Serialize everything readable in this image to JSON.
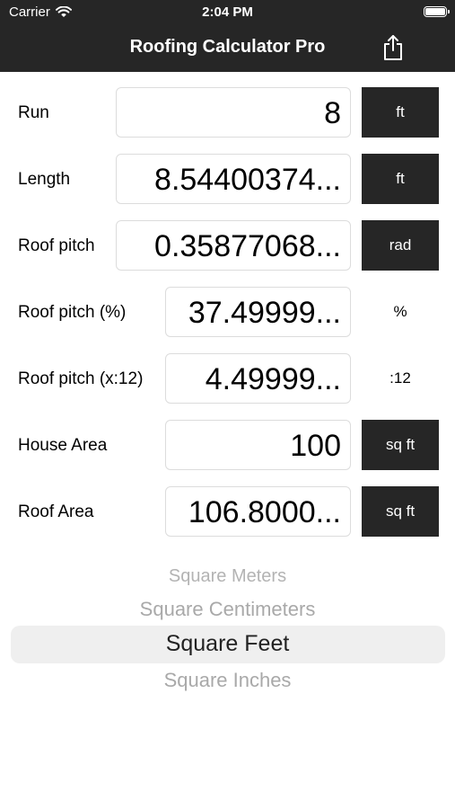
{
  "status": {
    "carrier": "Carrier",
    "time": "2:04 PM"
  },
  "nav": {
    "title": "Roofing Calculator Pro",
    "share_icon": "share-icon"
  },
  "rows": [
    {
      "label": "Run",
      "value": "8",
      "unit": "ft"
    },
    {
      "label": "Length",
      "value": "8.54400374...",
      "unit": "ft"
    },
    {
      "label": "Roof pitch",
      "value": "0.35877068...",
      "unit": "rad"
    },
    {
      "label": "Roof pitch (%)",
      "value": "37.49999...",
      "unit": "%"
    },
    {
      "label": "Roof pitch (x:12)",
      "value": "4.49999...",
      "unit": ":12"
    },
    {
      "label": "House Area",
      "value": "100",
      "unit": "sq ft"
    },
    {
      "label": "Roof Area",
      "value": "106.8000...",
      "unit": "sq ft"
    }
  ],
  "picker": {
    "items": [
      "Square Meters",
      "Square Centimeters",
      "Square Feet",
      "Square Inches"
    ],
    "selected": "Square Feet"
  },
  "colors": {
    "bar": "#262626",
    "unit_button": "#262626",
    "picker_dim": "#b3b3b3",
    "picker_selected": "#222222"
  }
}
